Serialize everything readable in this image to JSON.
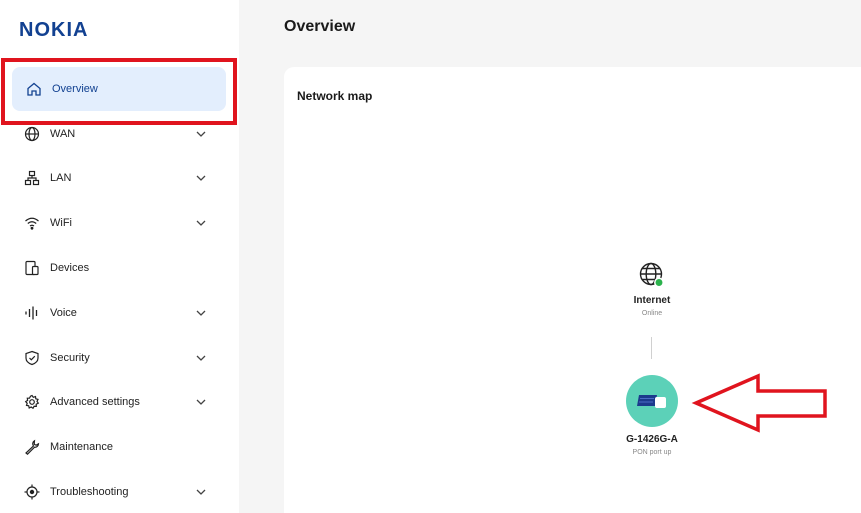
{
  "brand": {
    "logo_text": "NOKIA",
    "logo_color": "#124191"
  },
  "sidebar": {
    "items": [
      {
        "label": "Overview",
        "icon": "home-icon",
        "active": true
      },
      {
        "label": "WAN",
        "icon": "globe-icon",
        "expandable": true
      },
      {
        "label": "LAN",
        "icon": "network-tree-icon",
        "expandable": true
      },
      {
        "label": "WiFi",
        "icon": "wifi-icon",
        "expandable": true
      },
      {
        "label": "Devices",
        "icon": "devices-icon",
        "expandable": false
      },
      {
        "label": "Voice",
        "icon": "voice-icon",
        "expandable": true
      },
      {
        "label": "Security",
        "icon": "shield-icon",
        "expandable": true
      },
      {
        "label": "Advanced settings",
        "icon": "gear-icon",
        "expandable": true
      },
      {
        "label": "Maintenance",
        "icon": "wrench-icon",
        "expandable": false
      },
      {
        "label": "Troubleshooting",
        "icon": "crosshair-icon",
        "expandable": true
      }
    ]
  },
  "main": {
    "page_title": "Overview",
    "network_map": {
      "title": "Network map",
      "internet": {
        "label": "Internet",
        "status": "Online",
        "status_color": "#2bb24c"
      },
      "router": {
        "label": "G-1426G-A",
        "status": "PON port up",
        "node_color": "#5cd1b8"
      }
    }
  },
  "annotations": {
    "highlight_color": "#e0141e"
  }
}
